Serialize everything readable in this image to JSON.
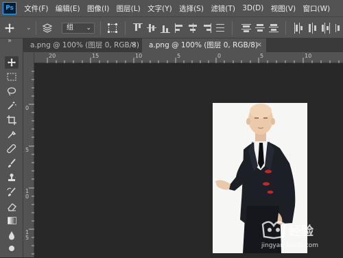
{
  "app": {
    "logo": "Ps"
  },
  "menu": [
    "文件(F)",
    "编辑(E)",
    "图像(I)",
    "图层(L)",
    "文字(Y)",
    "选择(S)",
    "滤镜(T)",
    "3D(D)",
    "视图(V)",
    "窗口(W)"
  ],
  "options": {
    "group_select": "组",
    "dropdown_icon": "chevron-down-icon"
  },
  "tabs": [
    {
      "label": "a.png @ 100% (图层 0, RGB/8)",
      "close": "×",
      "active": false
    },
    {
      "label": "a.png @ 100% (图层 0, RGB/8)",
      "close": "×",
      "active": true
    }
  ],
  "toolbar": {
    "collapse": "»"
  },
  "ruler": {
    "h": [
      "20",
      "15",
      "10",
      "5",
      "0",
      "5",
      "10"
    ],
    "v": [
      "0",
      "5",
      "1\n0",
      "1\n5"
    ]
  },
  "watermark": {
    "text": "经验",
    "sub": "jingyan.baidu.com"
  },
  "colors": {
    "chrome": "#535353",
    "workspace": "#282828",
    "accent": "#31a8ff",
    "tab_bar": "#3a3a3a"
  }
}
